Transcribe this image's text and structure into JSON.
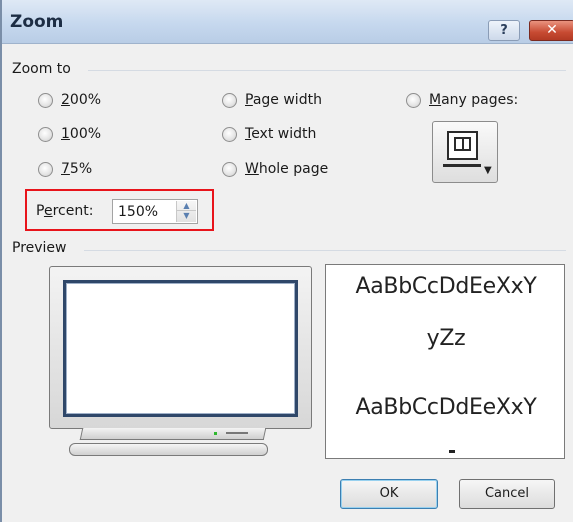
{
  "window": {
    "title": "Zoom",
    "help_label": "?",
    "close_label": "✕"
  },
  "zoom_to": {
    "group_label": "Zoom to",
    "options": [
      {
        "mnemonic": "2",
        "rest": "00%",
        "selected": false
      },
      {
        "mnemonic": "1",
        "rest": "00%",
        "selected": false
      },
      {
        "mnemonic": "7",
        "rest": "5%",
        "selected": false
      },
      {
        "mnemonic": "P",
        "rest": "age width",
        "selected": false
      },
      {
        "mnemonic": "T",
        "rest": "ext width",
        "selected": false
      },
      {
        "mnemonic": "W",
        "rest": "hole page",
        "selected": false
      },
      {
        "mnemonic": "M",
        "rest": "any pages:",
        "selected": false
      }
    ],
    "many_pages_button_icon": "monitor-pages-icon"
  },
  "percent": {
    "label_before": "P",
    "label_mnemonic": "e",
    "label_after": "rcent:",
    "value": "150%",
    "highlight_color": "#e8141b"
  },
  "preview": {
    "group_label": "Preview",
    "sample_lines": [
      "AaBbCcDdEeXxY",
      "yZz",
      "AaBbCcDdEeXxY"
    ]
  },
  "buttons": {
    "ok_label": "OK",
    "cancel_label": "Cancel"
  }
}
